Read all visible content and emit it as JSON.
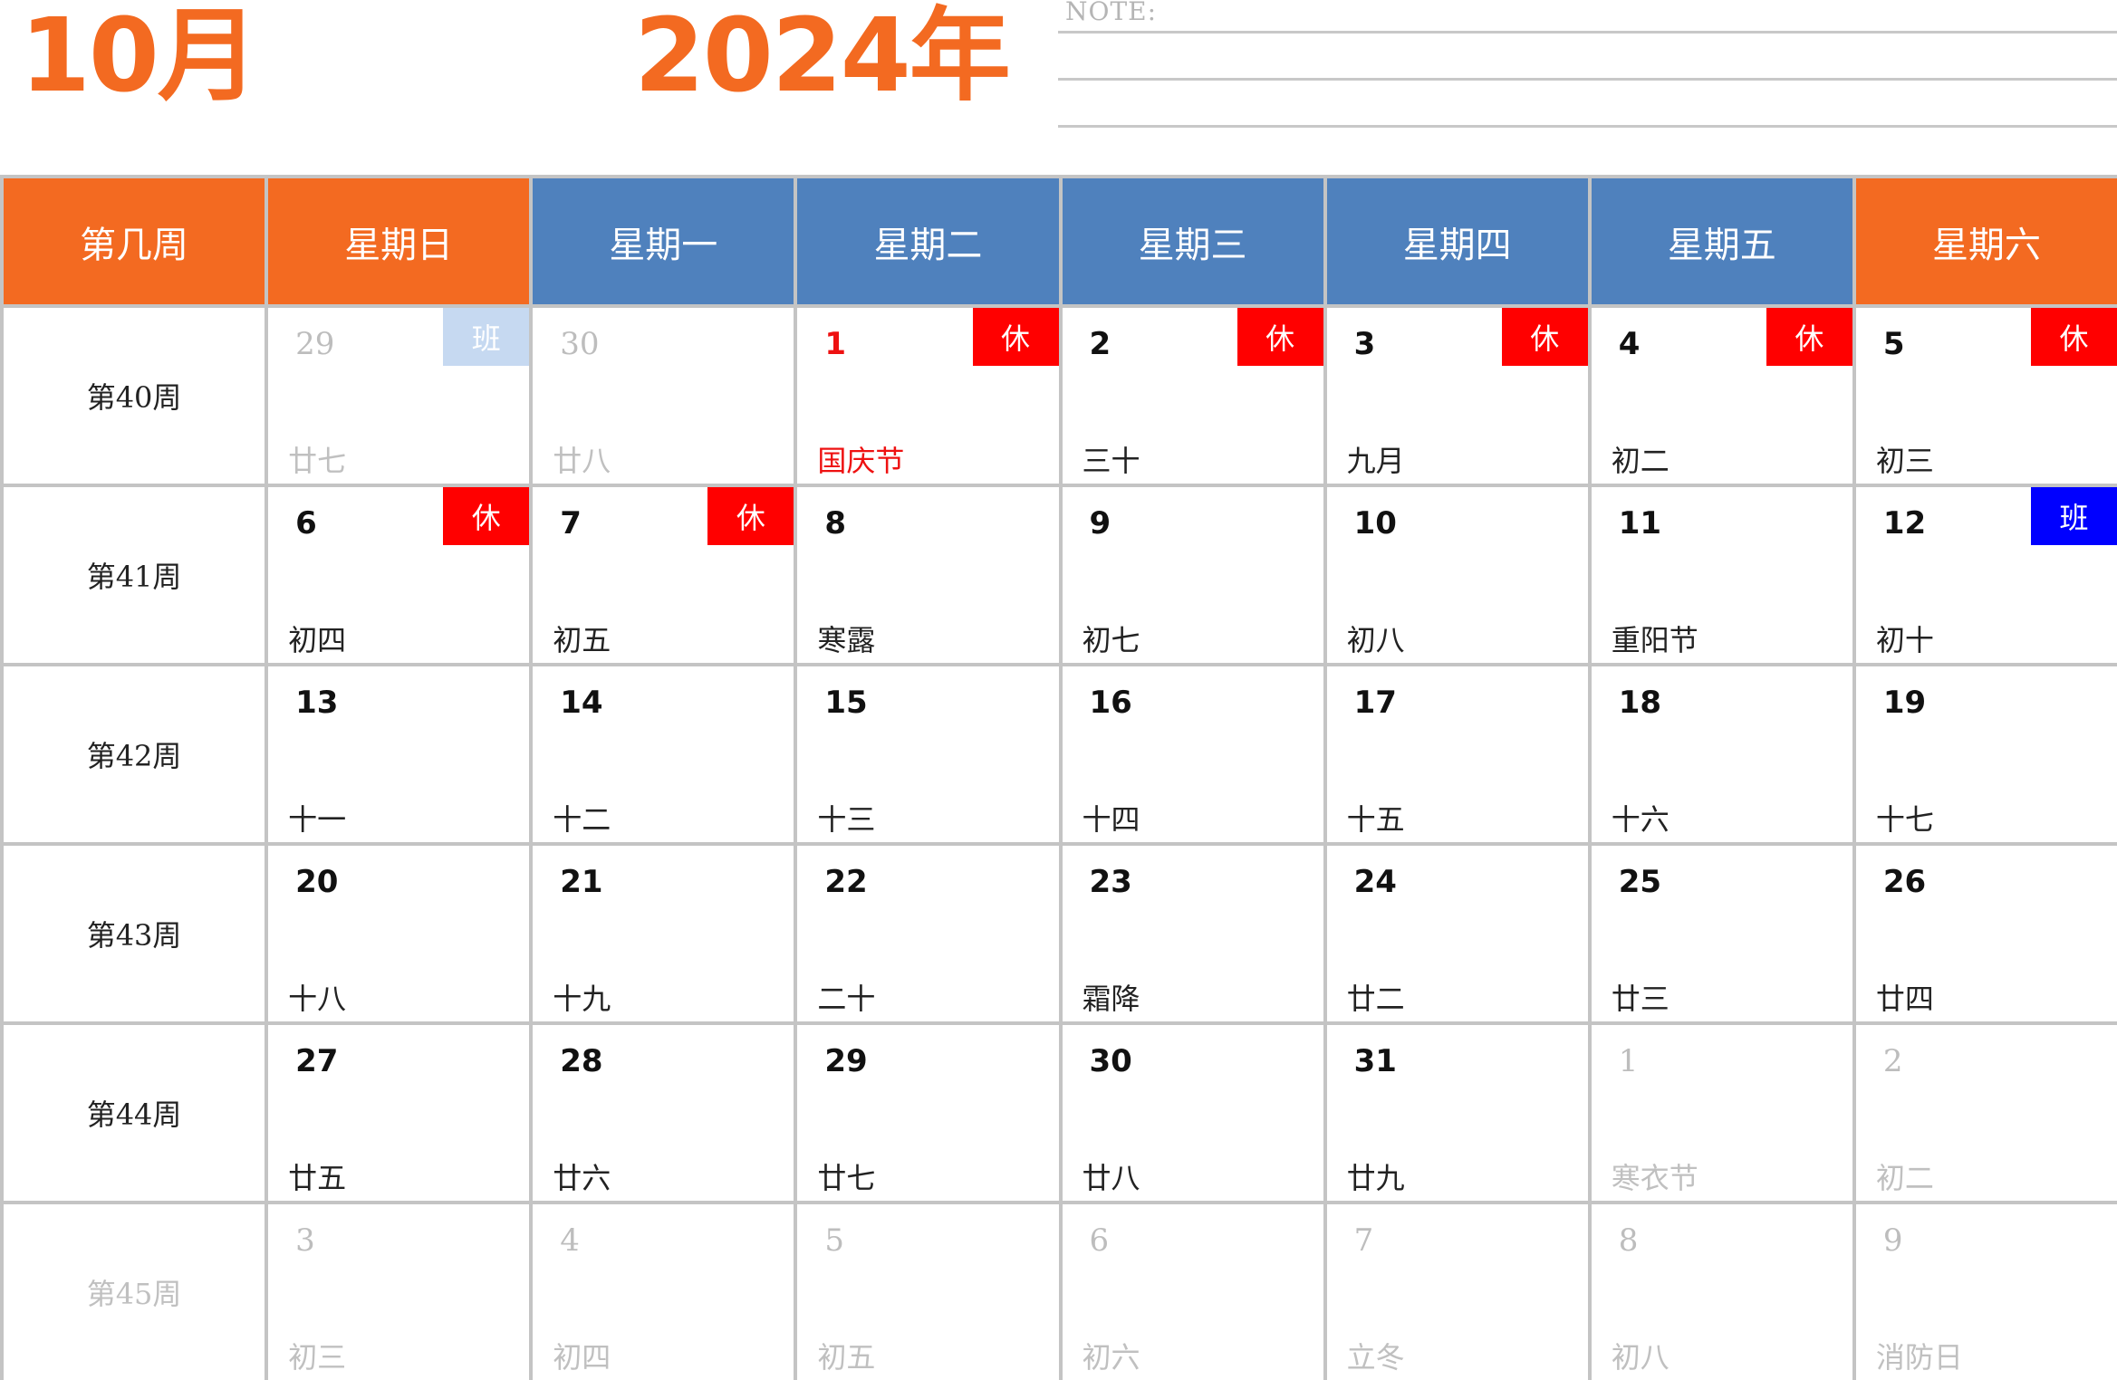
{
  "header": {
    "month": "10月",
    "year": "2024年",
    "note_label": "NOTE:"
  },
  "colors": {
    "orange": "#f36a21",
    "blue": "#4f81bd",
    "rest_badge": "#ff0000",
    "work_badge": "#0000ff",
    "work_badge_muted": "#c6d9f1",
    "muted_text": "#c0c0c0",
    "holiday_text": "#ee1111"
  },
  "columns": [
    {
      "label": "第几周",
      "color": "orange"
    },
    {
      "label": "星期日",
      "color": "orange"
    },
    {
      "label": "星期一",
      "color": "blue"
    },
    {
      "label": "星期二",
      "color": "blue"
    },
    {
      "label": "星期三",
      "color": "blue"
    },
    {
      "label": "星期四",
      "color": "blue"
    },
    {
      "label": "星期五",
      "color": "blue"
    },
    {
      "label": "星期六",
      "color": "orange"
    }
  ],
  "weeks": [
    {
      "label": "第40周",
      "muted": false,
      "days": [
        {
          "num": "29",
          "lunar": "廿七",
          "muted": true,
          "badge": "班",
          "badge_type": "work-muted"
        },
        {
          "num": "30",
          "lunar": "廿八",
          "muted": true
        },
        {
          "num": "1",
          "lunar": "国庆节",
          "holiday": true,
          "badge": "休",
          "badge_type": "rest"
        },
        {
          "num": "2",
          "lunar": "三十",
          "badge": "休",
          "badge_type": "rest"
        },
        {
          "num": "3",
          "lunar": "九月",
          "badge": "休",
          "badge_type": "rest"
        },
        {
          "num": "4",
          "lunar": "初二",
          "badge": "休",
          "badge_type": "rest"
        },
        {
          "num": "5",
          "lunar": "初三",
          "badge": "休",
          "badge_type": "rest"
        }
      ]
    },
    {
      "label": "第41周",
      "muted": false,
      "days": [
        {
          "num": "6",
          "lunar": "初四",
          "badge": "休",
          "badge_type": "rest"
        },
        {
          "num": "7",
          "lunar": "初五",
          "badge": "休",
          "badge_type": "rest"
        },
        {
          "num": "8",
          "lunar": "寒露"
        },
        {
          "num": "9",
          "lunar": "初七"
        },
        {
          "num": "10",
          "lunar": "初八"
        },
        {
          "num": "11",
          "lunar": "重阳节"
        },
        {
          "num": "12",
          "lunar": "初十",
          "badge": "班",
          "badge_type": "work"
        }
      ]
    },
    {
      "label": "第42周",
      "muted": false,
      "days": [
        {
          "num": "13",
          "lunar": "十一"
        },
        {
          "num": "14",
          "lunar": "十二"
        },
        {
          "num": "15",
          "lunar": "十三"
        },
        {
          "num": "16",
          "lunar": "十四"
        },
        {
          "num": "17",
          "lunar": "十五"
        },
        {
          "num": "18",
          "lunar": "十六"
        },
        {
          "num": "19",
          "lunar": "十七"
        }
      ]
    },
    {
      "label": "第43周",
      "muted": false,
      "days": [
        {
          "num": "20",
          "lunar": "十八"
        },
        {
          "num": "21",
          "lunar": "十九"
        },
        {
          "num": "22",
          "lunar": "二十"
        },
        {
          "num": "23",
          "lunar": "霜降"
        },
        {
          "num": "24",
          "lunar": "廿二"
        },
        {
          "num": "25",
          "lunar": "廿三"
        },
        {
          "num": "26",
          "lunar": "廿四"
        }
      ]
    },
    {
      "label": "第44周",
      "muted": false,
      "days": [
        {
          "num": "27",
          "lunar": "廿五"
        },
        {
          "num": "28",
          "lunar": "廿六"
        },
        {
          "num": "29",
          "lunar": "廿七"
        },
        {
          "num": "30",
          "lunar": "廿八"
        },
        {
          "num": "31",
          "lunar": "廿九"
        },
        {
          "num": "1",
          "lunar": "寒衣节",
          "muted": true
        },
        {
          "num": "2",
          "lunar": "初二",
          "muted": true
        }
      ]
    },
    {
      "label": "第45周",
      "muted": true,
      "days": [
        {
          "num": "3",
          "lunar": "初三",
          "muted": true
        },
        {
          "num": "4",
          "lunar": "初四",
          "muted": true
        },
        {
          "num": "5",
          "lunar": "初五",
          "muted": true
        },
        {
          "num": "6",
          "lunar": "初六",
          "muted": true
        },
        {
          "num": "7",
          "lunar": "立冬",
          "muted": true
        },
        {
          "num": "8",
          "lunar": "初八",
          "muted": true
        },
        {
          "num": "9",
          "lunar": "消防日",
          "muted": true
        }
      ]
    }
  ]
}
